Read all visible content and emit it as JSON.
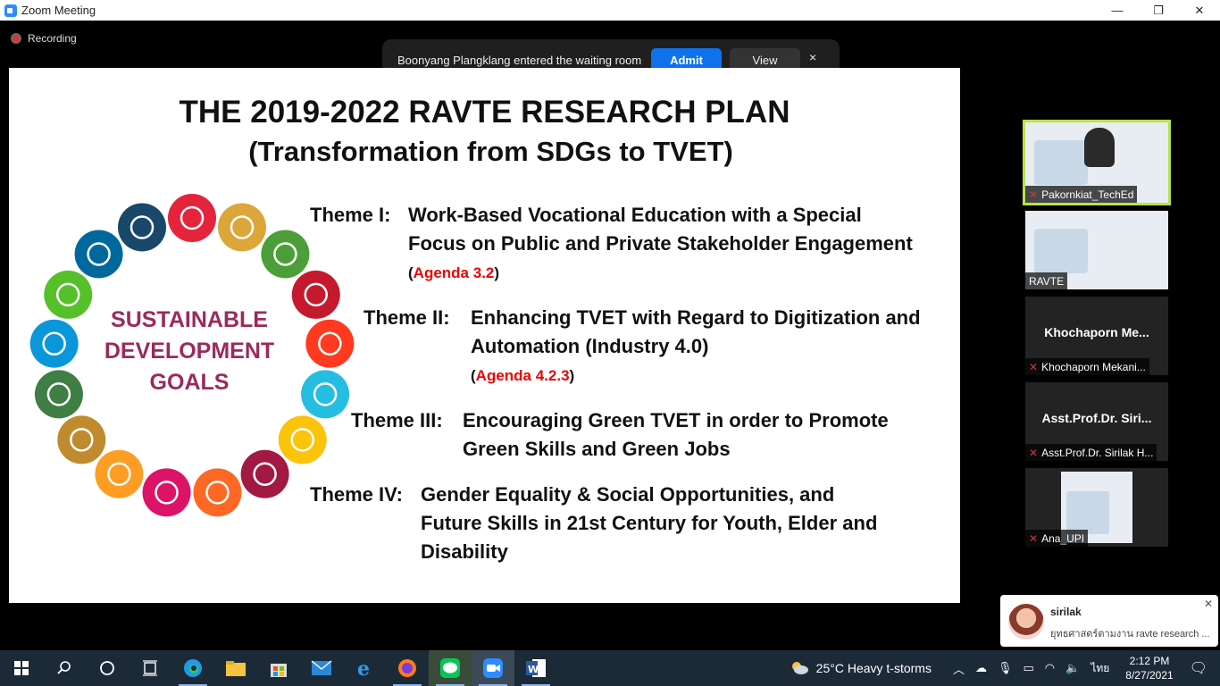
{
  "window": {
    "title": "Zoom Meeting",
    "min": "—",
    "max": "❐",
    "close": "✕"
  },
  "recording": {
    "label": "Recording"
  },
  "notice": {
    "text": "Boonyang Plangklang entered the waiting room",
    "admit": "Admit",
    "view": "View",
    "close": "×"
  },
  "slide": {
    "title": "THE 2019-2022 RAVTE RESEARCH PLAN",
    "subtitle": "(Transformation from SDGs to TVET)",
    "sdg_center": [
      "SUSTAINABLE",
      "DEVELOPMENT",
      "GOALS"
    ],
    "themes": [
      {
        "label": "Theme I:",
        "lines": [
          "Work-Based Vocational Education with a Special",
          "Focus on Public and Private Stakeholder Engagement"
        ],
        "agenda": "Agenda 3.2"
      },
      {
        "label": "Theme II:",
        "lines": [
          "Enhancing TVET with Regard to Digitization and",
          "Automation (Industry 4.0)"
        ],
        "agenda": "Agenda 4.2.3"
      },
      {
        "label": "Theme III:",
        "lines": [
          "Encouraging Green TVET in order to Promote",
          "Green Skills and Green Jobs"
        ],
        "agenda": ""
      },
      {
        "label": "Theme IV:",
        "lines": [
          "Gender Equality & Social Opportunities, and",
          "Future Skills in 21st Century for Youth, Elder and",
          "Disability"
        ],
        "agenda": ""
      }
    ],
    "sdg_colors": [
      "#e5243b",
      "#dda63a",
      "#4c9f38",
      "#c5192d",
      "#ff3a21",
      "#26bde2",
      "#fcc30b",
      "#a21942",
      "#fd6925",
      "#dd1367",
      "#fd9d24",
      "#bf8b2e",
      "#3f7e44",
      "#0a97d9",
      "#56c02b",
      "#00689d",
      "#19486a"
    ]
  },
  "participants": [
    {
      "label": "Pakornkiat_TechEd",
      "active": true
    },
    {
      "label": "RAVTE"
    },
    {
      "big": "Khochaporn  Me...",
      "label": "Khochaporn Mekani..."
    },
    {
      "big": "Asst.Prof.Dr.  Siri...",
      "label": "Asst.Prof.Dr. Sirilak H..."
    },
    {
      "label": "Ana_UPI"
    }
  ],
  "chat": {
    "sender": "sirilak",
    "message": "ยุทธศาสตร์ตามงาน ravte research ...",
    "close": "✕"
  },
  "taskbar": {
    "weather": "25°C  Heavy t-storms",
    "lang": "ไทย",
    "time": "2:12 PM",
    "date": "8/27/2021",
    "colors": {
      "bg": "#1c2a38",
      "accent": "#0e72ed"
    }
  }
}
